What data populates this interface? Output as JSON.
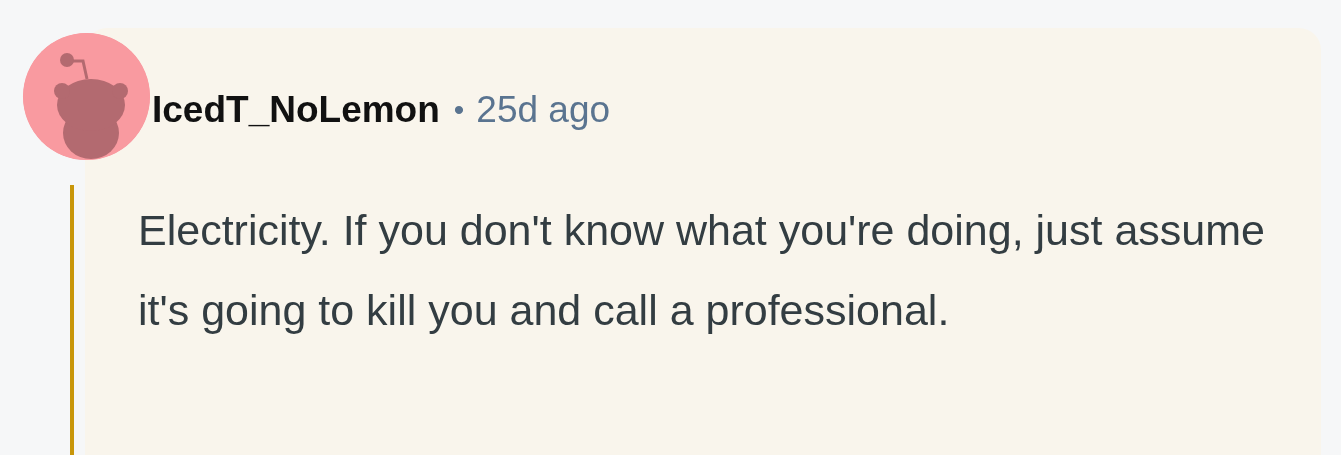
{
  "comment": {
    "username": "IcedT_NoLemon",
    "separator": "•",
    "age": "25d ago",
    "body": "Electricity. If you don't know what you're doing, just assume it's going to kill you and call a professional."
  }
}
